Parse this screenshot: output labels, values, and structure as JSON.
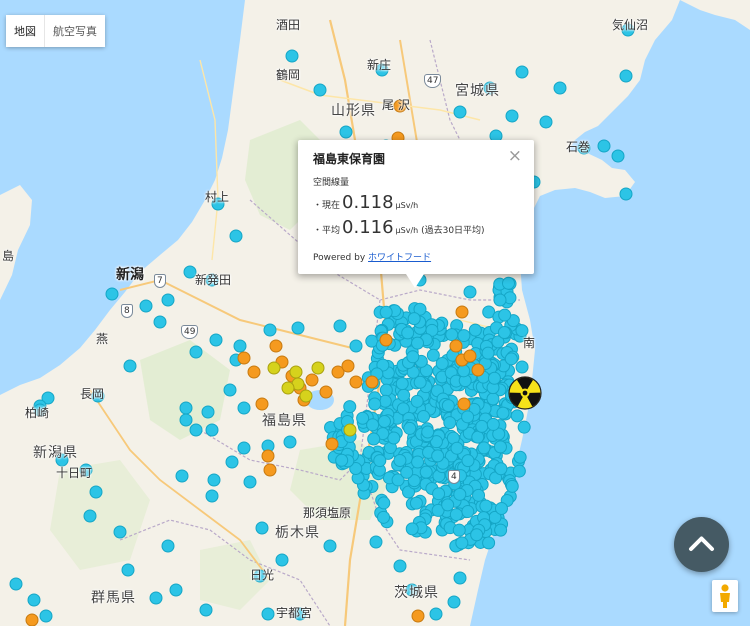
{
  "map_controls": {
    "map_label": "地図",
    "satellite_label": "航空写真"
  },
  "popup": {
    "title": "福島東保育園",
    "subtitle": "空間線量",
    "current_prefix": "・現在",
    "current_value": "0.118",
    "unit": "μSv/h",
    "average_prefix": "・平均",
    "average_value": "0.116",
    "average_note": "(過去30日平均)",
    "powered_by": "Powered by",
    "powered_link": "ホワイトフード",
    "close_glyph": "×"
  },
  "colors": {
    "water": "#aadaff",
    "land": "#f4f1e8",
    "station": "#2cc4e6",
    "station_border": "#15a6c6",
    "elevated": "#f59a1f",
    "moderate": "#d6d21c",
    "nuclear": "#f6e21a"
  },
  "place_labels": [
    {
      "id": "sakata",
      "text": "酒田"
    },
    {
      "id": "tsuruoka",
      "text": "鶴岡"
    },
    {
      "id": "shinjo",
      "text": "新庄"
    },
    {
      "id": "yamagata",
      "text": "山形県"
    },
    {
      "id": "obanazawa",
      "text": "尾  沢"
    },
    {
      "id": "miyagi",
      "text": "宮城県"
    },
    {
      "id": "kesennuma",
      "text": "気仙沼"
    },
    {
      "id": "ishinomaki",
      "text": "石巻"
    },
    {
      "id": "murakami",
      "text": "村上"
    },
    {
      "id": "niigata",
      "text": "新潟"
    },
    {
      "id": "shibata",
      "text": "新発田"
    },
    {
      "id": "tsubame",
      "text": "燕"
    },
    {
      "id": "nagaoka",
      "text": "長岡"
    },
    {
      "id": "kashiwazaki",
      "text": "柏崎"
    },
    {
      "id": "niigata-pref",
      "text": "新潟県"
    },
    {
      "id": "tokamachi",
      "text": "十日町"
    },
    {
      "id": "fukushima",
      "text": "福島県"
    },
    {
      "id": "nasushiobara",
      "text": "那須塩原"
    },
    {
      "id": "tochigi",
      "text": "栃木県"
    },
    {
      "id": "nikko",
      "text": "日光"
    },
    {
      "id": "utsunomiya",
      "text": "宇都宮"
    },
    {
      "id": "gunma",
      "text": "群馬県"
    },
    {
      "id": "ibaraki",
      "text": "茨城県"
    },
    {
      "id": "sado",
      "text": "島"
    },
    {
      "id": "soma",
      "text": "南"
    }
  ],
  "route_shields": [
    {
      "id": "r47",
      "text": "47"
    },
    {
      "id": "r7",
      "text": "7"
    },
    {
      "id": "r8",
      "text": "8"
    },
    {
      "id": "r49",
      "text": "49"
    },
    {
      "id": "r4",
      "text": "4"
    }
  ],
  "icons": {
    "nuclear": "radiation-hazard-icon",
    "scroll_top": "chevron-up-icon",
    "street_view": "pegman-icon"
  }
}
